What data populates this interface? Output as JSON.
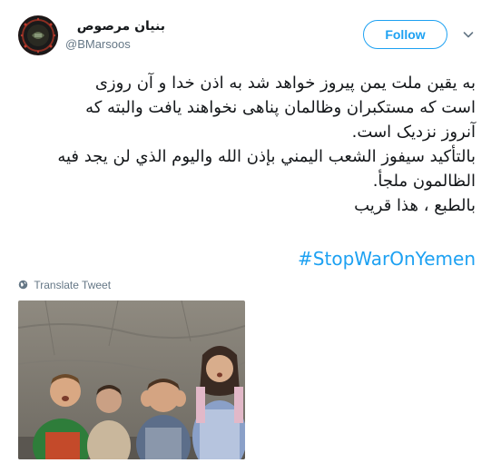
{
  "user": {
    "display_name": "بنیان مرصوص",
    "handle": "@BMarsoos"
  },
  "follow_button": {
    "label": "Follow"
  },
  "icons": {
    "menu": "chevron-down-icon",
    "translate": "globe-icon"
  },
  "tweet": {
    "lines": [
      "به یقین ملت یمن پیروز خواهد شد به اذن خدا و آن روزی",
      "است که مستکبران وظالمان پناهی نخواهند یافت والبته که",
      "آنروز نزدیک است.",
      "بالتأكيد سيفوز الشعب اليمني بإذن الله واليوم الذي لن يجد فيه",
      "الظالمون ملجأ.",
      "بالطبع ، هذا قريب"
    ],
    "hashtag": "#StopWarOnYemen"
  },
  "translate": {
    "label": "Translate Tweet"
  },
  "colors": {
    "accent": "#1da1f2",
    "text_primary": "#14171a",
    "text_secondary": "#657786"
  }
}
